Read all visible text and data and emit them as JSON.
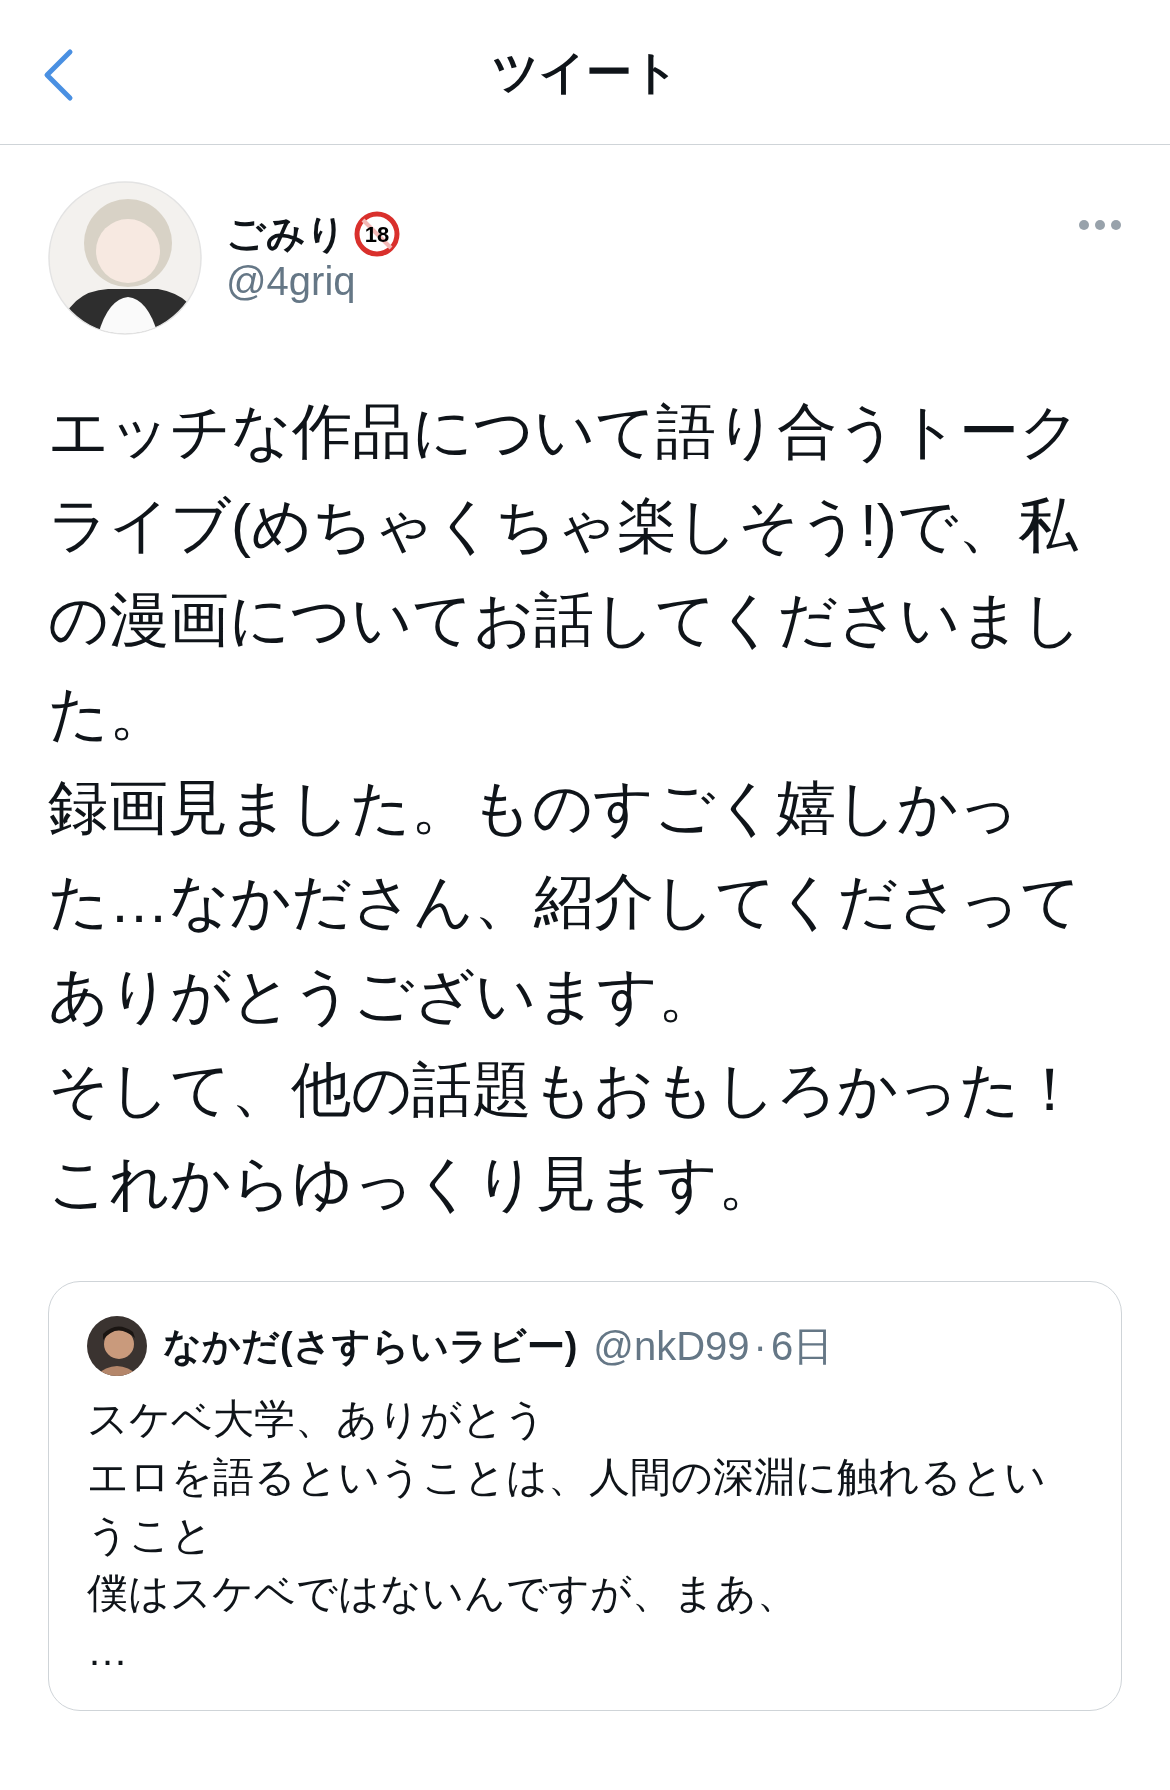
{
  "header": {
    "title": "ツイート"
  },
  "tweet": {
    "name": "ごみり",
    "age_badge": "18",
    "handle": "@4griq",
    "paragraphs": [
      "エッチな作品について語り合うトークライブ(めちゃくちゃ楽しそう!)で、私の漫画についてお話してくださいました。",
      "録画見ました。ものすごく嬉しかった…なかださん、紹介してくださってありがとうございます。",
      "そして、他の話題もおもしろかった！",
      "これからゆっくり見ます。"
    ]
  },
  "quote": {
    "name": "なかだ(さすらいラビー)",
    "handle": "@nkD99",
    "separator": "·",
    "time": "6日",
    "paragraphs": [
      "スケベ大学、ありがとう",
      "エロを語るということは、人間の深淵に触れるということ",
      "僕はスケベではないんですが、まあ、",
      "…"
    ]
  }
}
